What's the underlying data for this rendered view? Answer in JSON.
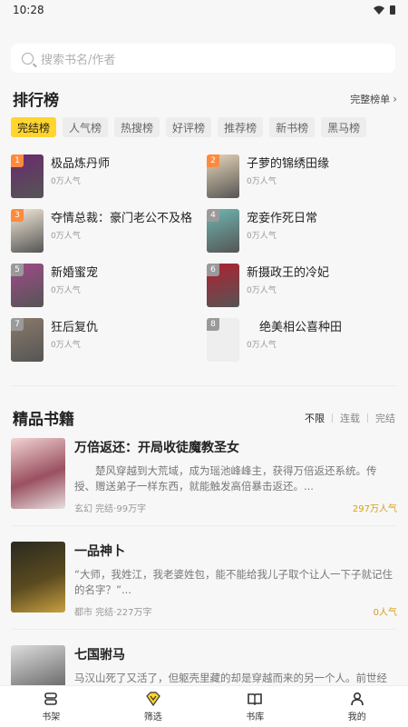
{
  "status": {
    "time": "10:28"
  },
  "search": {
    "placeholder": "搜索书名/作者"
  },
  "ranking": {
    "title": "排行榜",
    "more_label": "完整榜单",
    "tabs": [
      "完结榜",
      "人气榜",
      "热搜榜",
      "好评榜",
      "推荐榜",
      "新书榜",
      "黑马榜"
    ],
    "active_tab": 0,
    "items": [
      {
        "rank": "1",
        "title": "极品炼丹师",
        "popularity": "0万人气",
        "color": "#6a2a6e"
      },
      {
        "rank": "2",
        "title": "子萝的锦绣田缘",
        "popularity": "0万人气",
        "color": "#e8d6b8"
      },
      {
        "rank": "3",
        "title": "夺情总裁：豪门老公不及格",
        "popularity": "0万人气",
        "color": "#f5ead8"
      },
      {
        "rank": "4",
        "title": "宠妾作死日常",
        "popularity": "0万人气",
        "color": "#6fb6b0"
      },
      {
        "rank": "5",
        "title": "新婚蜜宠",
        "popularity": "0万人气",
        "color": "#a04a8a"
      },
      {
        "rank": "6",
        "title": "新摄政王的冷妃",
        "popularity": "0万人气",
        "color": "#b02030"
      },
      {
        "rank": "7",
        "title": "狂后复仇",
        "popularity": "0万人气",
        "color": "#8a7a6a"
      },
      {
        "rank": "8",
        "title": "绝美相公喜种田",
        "popularity": "0万人气",
        "color": "#eeeeee"
      }
    ]
  },
  "premium": {
    "title": "精品书籍",
    "filters": [
      "不限",
      "连载",
      "完结"
    ],
    "books": [
      {
        "title": "万倍返还：开局收徒魔教圣女",
        "desc": "楚风穿越到大荒域，成为瑶池峰峰主，获得万倍返还系统。传授、赠送弟子一样东西，就能触发高倍暴击返还。...",
        "meta": "玄幻 完结·99万字",
        "popularity": "297万人气"
      },
      {
        "title": "一品神卜",
        "desc": "“大师，我姓江，我老婆姓包，能不能给我儿子取个让人一下子就记住的名字？”...",
        "meta": "都市 完结·227万字",
        "popularity": "0人气"
      },
      {
        "title": "七国驸马",
        "desc": "马汉山死了又活了，但躯壳里藏的却是穿越而来的另一个人。前世经历太",
        "meta": "",
        "popularity": ""
      }
    ]
  },
  "nav": [
    "书架",
    "筛选",
    "书库",
    "我的"
  ],
  "colors": {
    "accent": "#ffd52e",
    "rank_top": "#ff8a3d",
    "rank_other": "#9a9a9a"
  }
}
